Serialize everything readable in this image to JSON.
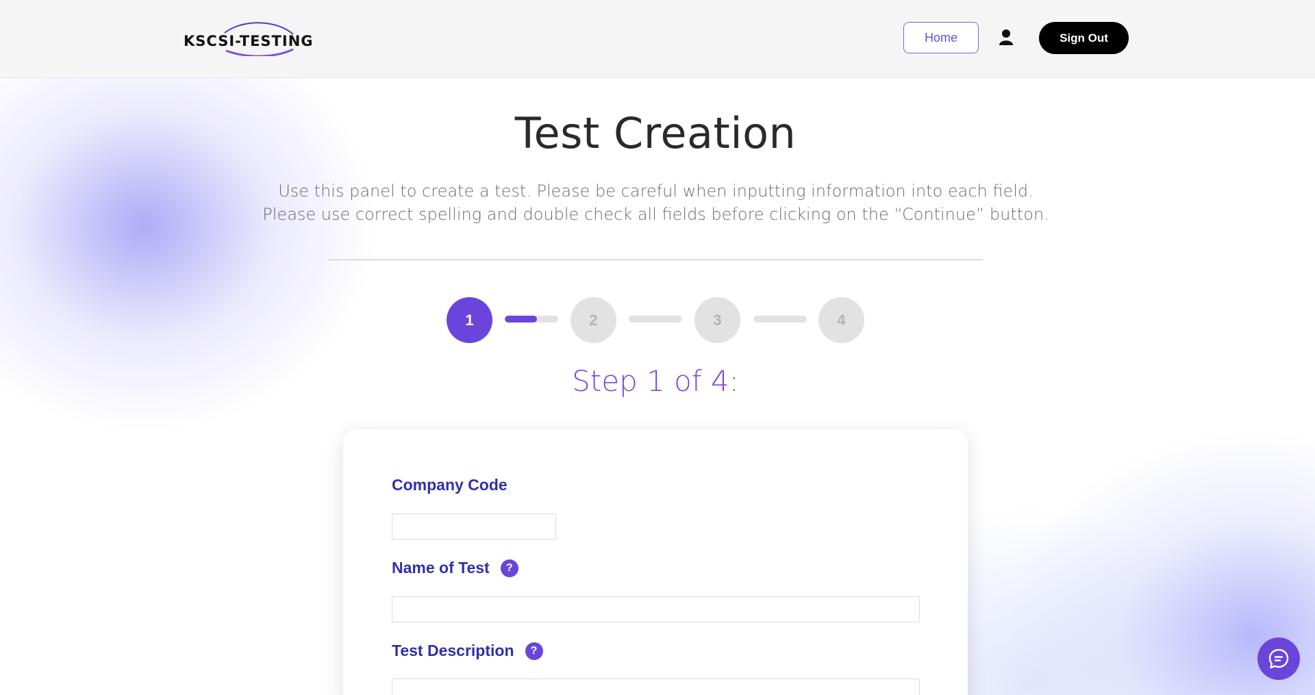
{
  "header": {
    "logo_text": "KSCSI-TESTING",
    "nav_home": "Home",
    "nav_user_icon": "user-icon",
    "nav_signout": "Sign Out"
  },
  "main": {
    "title": "Test Creation",
    "description": "Use this panel to create a test. Please be careful when inputting information into each field. Please use correct spelling and double check all fields before clicking on the “Continue” button.",
    "stepper": {
      "steps": [
        "1",
        "2",
        "3",
        "4"
      ],
      "current_step": 1,
      "progress_bars": [
        0.6,
        0,
        0
      ],
      "label": "Step 1 of 4:"
    },
    "form": {
      "fields": [
        {
          "label": "Company Code",
          "value": "",
          "help": false
        },
        {
          "label": "Name of Test",
          "value": "",
          "help": true,
          "help_symbol": "?"
        },
        {
          "label": "Test Description",
          "value": "",
          "help": true,
          "help_symbol": "?"
        }
      ]
    }
  },
  "chat": {
    "icon": "chat-bubble-icon"
  },
  "colors": {
    "accent": "#6a45dc",
    "label": "#3130a8",
    "step_label": "#7548de",
    "inactive": "#e2e2e2"
  }
}
